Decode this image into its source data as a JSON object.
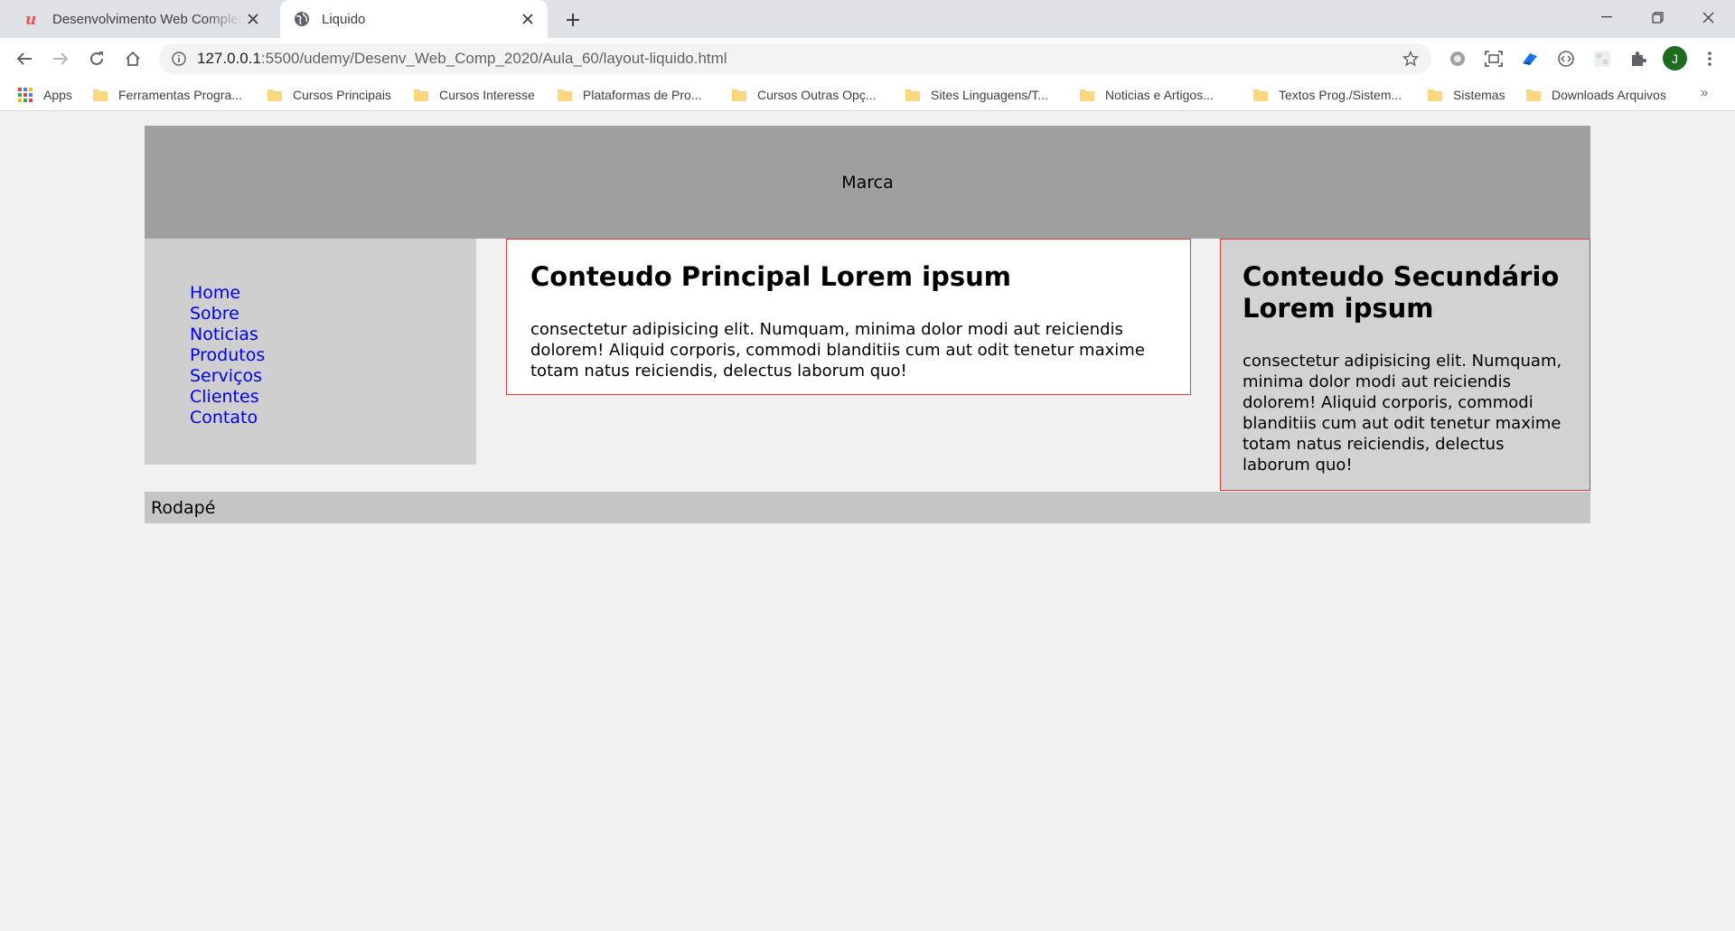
{
  "browser": {
    "tabs": [
      {
        "title": "Desenvolvimento Web Completo",
        "icon": "udemy-logo-icon",
        "active": false
      },
      {
        "title": "Liquido",
        "icon": "globe-icon",
        "active": true
      }
    ],
    "url_host": "127.0.0.1",
    "url_path": ":5500/udemy/Desenv_Web_Comp_2020/Aula_60/layout-liquido.html",
    "profile_initial": "J",
    "bookmarks": [
      {
        "label": "Apps",
        "icon": "apps-grid-icon"
      },
      {
        "label": "Ferramentas Progra...",
        "icon": "folder-icon"
      },
      {
        "label": "Cursos Principais",
        "icon": "folder-icon"
      },
      {
        "label": "Cursos Interesse",
        "icon": "folder-icon"
      },
      {
        "label": "Plataformas de Pro...",
        "icon": "folder-icon"
      },
      {
        "label": "Cursos Outras Opç...",
        "icon": "folder-icon"
      },
      {
        "label": "Sites Linguagens/T...",
        "icon": "folder-icon"
      },
      {
        "label": "Noticias e Artigos...",
        "icon": "folder-icon"
      },
      {
        "label": "Textos Prog./Sistem...",
        "icon": "folder-icon"
      },
      {
        "label": "Sistemas",
        "icon": "folder-icon"
      },
      {
        "label": "Downloads Arquivos",
        "icon": "folder-icon"
      }
    ],
    "more_bookmarks": "»"
  },
  "page": {
    "header": "Marca",
    "nav": [
      {
        "label": "Home"
      },
      {
        "label": "Sobre"
      },
      {
        "label": "Noticias"
      },
      {
        "label": "Produtos"
      },
      {
        "label": "Serviços"
      },
      {
        "label": "Clientes"
      },
      {
        "label": "Contato"
      }
    ],
    "main": {
      "title": "Conteudo Principal Lorem ipsum",
      "text": "consectetur adipisicing elit. Numquam, minima dolor modi aut reiciendis dolorem! Aliquid corporis, commodi blanditiis cum aut odit tenetur maxime totam natus reiciendis, delectus laborum quo!"
    },
    "secondary": {
      "title": "Conteudo Secundário Lorem ipsum",
      "text": "consectetur adipisicing elit. Numquam, minima dolor modi aut reiciendis dolorem! Aliquid corporis, commodi blanditiis cum aut odit tenetur maxime totam natus reiciendis, delectus laborum quo!"
    },
    "footer": "Rodapé"
  },
  "colors": {
    "header_bg": "#9f9f9f",
    "sidebar_bg": "#cfcfcf",
    "secondary_bg": "#d2d2d2",
    "footer_bg": "#c5c5c5",
    "border_red": "#e63a3a",
    "link_blue": "#0000ee"
  }
}
